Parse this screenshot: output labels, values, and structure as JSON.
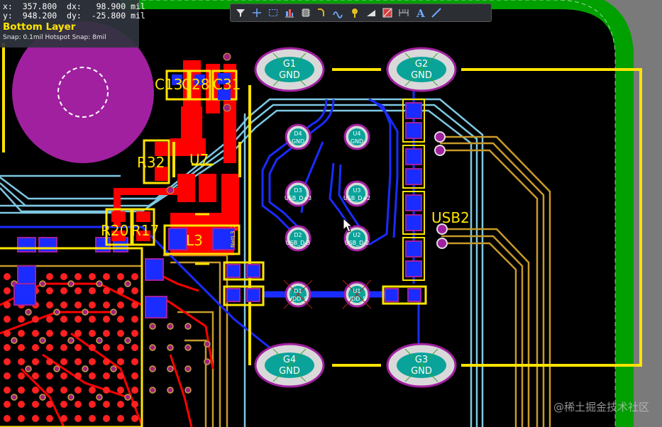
{
  "coords": {
    "x_label": "x:",
    "x_val": "357.800",
    "dx_label": "dx:",
    "dx_val": "98.900 mil",
    "y_label": "y:",
    "y_val": "948.200",
    "dy_label": "dy:",
    "dy_val": "-25.800 mil",
    "layer": "Bottom Layer",
    "snap": "Snap: 0.1mil Hotspot Snap: 8mil"
  },
  "toolbar": [
    {
      "name": "filter-icon"
    },
    {
      "name": "crosshair-icon"
    },
    {
      "name": "select-rectangle-icon"
    },
    {
      "name": "align-icon"
    },
    {
      "name": "component-icon"
    },
    {
      "name": "route-icon"
    },
    {
      "name": "diff-pair-icon"
    },
    {
      "name": "via-icon"
    },
    {
      "name": "fill-icon"
    },
    {
      "name": "polygon-icon"
    },
    {
      "name": "dimension-icon"
    },
    {
      "name": "text-icon"
    },
    {
      "name": "line-icon"
    }
  ],
  "components": {
    "c13": "C13",
    "c28": "C28",
    "c31": "C31",
    "r32": "R32",
    "u7": "U7",
    "r20": "R20",
    "r17": "R17",
    "l3": "L3",
    "net_label": "NetL3_2",
    "usb2": "USB2",
    "g1": {
      "ref": "G1",
      "net": "GND"
    },
    "g2": {
      "ref": "G2",
      "net": "GND"
    },
    "g3": {
      "ref": "G3",
      "net": "GND"
    },
    "g4": {
      "ref": "G4",
      "net": "GND"
    },
    "d4": {
      "ref": "D4",
      "net": "GND"
    },
    "u4": {
      "ref": "U4",
      "net": "GND"
    },
    "d3": {
      "ref": "D3",
      "net": "USB_D+3"
    },
    "u3": {
      "ref": "U3",
      "net": "USB_D+2"
    },
    "d2": {
      "ref": "D2",
      "net": "USB_D-3"
    },
    "u2": {
      "ref": "U2",
      "net": "USB_D-2"
    },
    "d1": {
      "ref": "D1",
      "net": "VDD_5"
    },
    "u1": {
      "ref": "U1",
      "net": "VDD_5"
    }
  },
  "watermark": "@稀土掘金技术社区",
  "colors": {
    "board_outline": "#00a000",
    "top_copper": "#ff0000",
    "bottom_copper": "#0022ff",
    "silkscreen": "#ffe400",
    "pad_ring": "#d9d9d9",
    "pad_center": "#0aa39a",
    "light_blue_trace": "#7ec8e3",
    "gold_trace": "#c89a2a",
    "magenta_pad": "#a020a0"
  }
}
